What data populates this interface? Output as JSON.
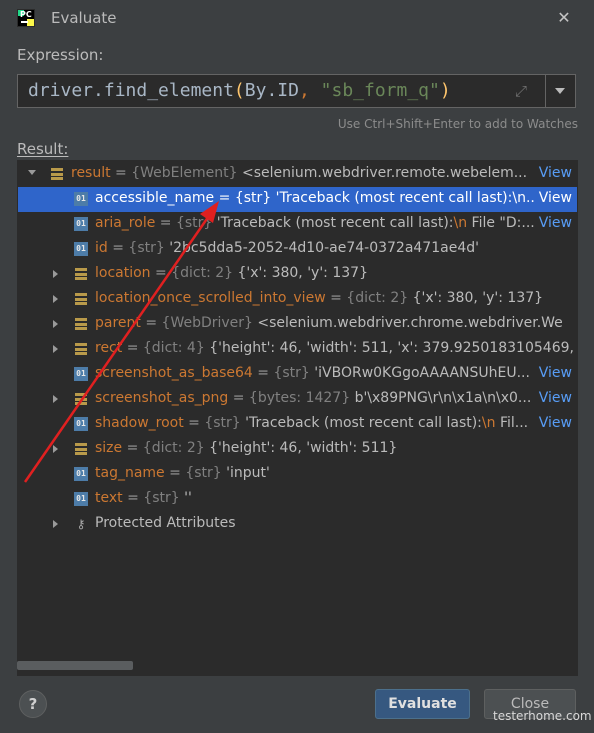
{
  "window": {
    "title": "Evaluate",
    "app_icon": "pycharm-icon",
    "close_icon": "close-icon"
  },
  "expression": {
    "label": "Expression:",
    "parts": [
      "driver",
      ".find_element",
      "(",
      "By.ID",
      ", ",
      "\"sb_form_q\"",
      ")"
    ],
    "hint": "Use Ctrl+Shift+Enter to add to Watches"
  },
  "result": {
    "label": "Result:",
    "rows": [
      {
        "name": "result",
        "type": "{WebElement}",
        "value": "<selenium.webdriver.remote.webelem...",
        "view": "View",
        "icon": "object-icon",
        "expander": "down"
      },
      {
        "name": "accessible_name",
        "type": "{str}",
        "value": "'Traceback (most recent call last):\\n...",
        "view": "View",
        "icon": "primitive-icon",
        "expander": "none",
        "selected": true
      },
      {
        "name": "aria_role",
        "type": "{str}",
        "value": "'Traceback (most recent call last):",
        "esc": "\\n",
        "value2": " File \"D:...",
        "view": "View",
        "icon": "primitive-icon",
        "expander": "none"
      },
      {
        "name": "id",
        "type": "{str}",
        "value": "'2bc5dda5-2052-4d10-ae74-0372a471ae4d'",
        "icon": "primitive-icon",
        "expander": "none"
      },
      {
        "name": "location",
        "type": "{dict: 2}",
        "value": "{'x': 380, 'y': 137}",
        "icon": "object-icon",
        "expander": "right"
      },
      {
        "name": "location_once_scrolled_into_view",
        "type": "{dict: 2}",
        "value": "{'x': 380, 'y': 137}",
        "icon": "object-icon",
        "expander": "right"
      },
      {
        "name": "parent",
        "type": "{WebDriver}",
        "value": "<selenium.webdriver.chrome.webdriver.We",
        "icon": "object-icon",
        "expander": "right"
      },
      {
        "name": "rect",
        "type": "{dict: 4}",
        "value": "{'height': 46, 'width': 511, 'x': 379.9250183105469, '",
        "icon": "object-icon",
        "expander": "right"
      },
      {
        "name": "screenshot_as_base64",
        "type": "{str}",
        "value": "'iVBORw0KGgoAAAANSUhEU...",
        "view": "View",
        "icon": "primitive-icon",
        "expander": "none"
      },
      {
        "name": "screenshot_as_png",
        "type": "{bytes: 1427}",
        "value": "b'\\x89PNG\\r\\n\\x1a\\n\\x0...",
        "view": "View",
        "icon": "object-icon",
        "expander": "right"
      },
      {
        "name": "shadow_root",
        "type": "{str}",
        "value": "'Traceback (most recent call last):",
        "esc": "\\n",
        "value2": " Fil...",
        "view": "View",
        "icon": "primitive-icon",
        "expander": "none"
      },
      {
        "name": "size",
        "type": "{dict: 2}",
        "value": "{'height': 46, 'width': 511}",
        "icon": "object-icon",
        "expander": "right"
      },
      {
        "name": "tag_name",
        "type": "{str}",
        "value": "'input'",
        "icon": "primitive-icon",
        "expander": "none"
      },
      {
        "name": "text",
        "type": "{str}",
        "value": "''",
        "icon": "primitive-icon",
        "expander": "none"
      },
      {
        "plain": "Protected Attributes",
        "icon": "key-icon",
        "expander": "right"
      }
    ]
  },
  "buttons": {
    "help": "?",
    "evaluate": "Evaluate",
    "close": "Close"
  },
  "watermark": "testerhome.com",
  "colors": {
    "background": "#3c3f41",
    "tree_bg": "#2b2b2b",
    "selection": "#2f65ca",
    "var_name": "#cc7832",
    "link": "#589df6",
    "annotation_arrow": "#e02020"
  }
}
